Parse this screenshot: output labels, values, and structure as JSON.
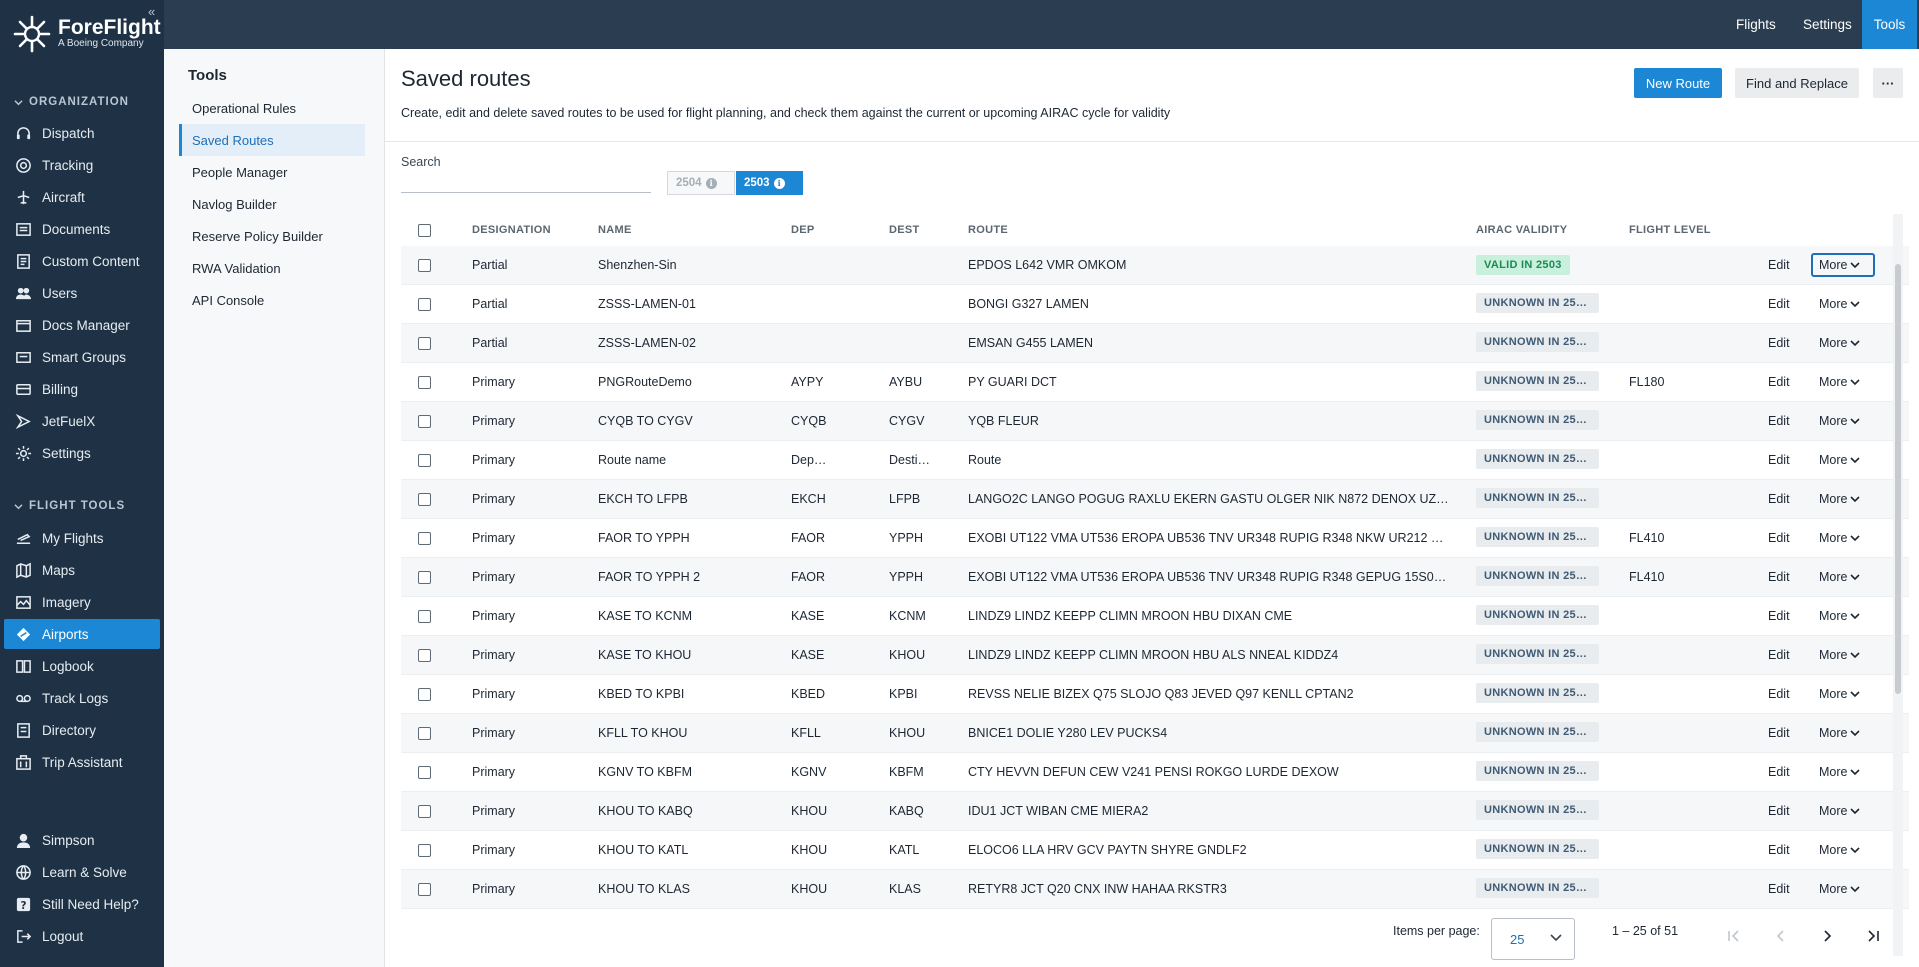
{
  "brand": {
    "name": "ForeFlight",
    "sub": "A Boeing Company"
  },
  "nav": {
    "org_heading": "ORGANIZATION",
    "org_items": [
      {
        "label": "Dispatch",
        "icon": "headset-icon"
      },
      {
        "label": "Tracking",
        "icon": "tracking-icon"
      },
      {
        "label": "Aircraft",
        "icon": "plane-icon"
      },
      {
        "label": "Documents",
        "icon": "documents-icon"
      },
      {
        "label": "Custom Content",
        "icon": "custom-content-icon"
      },
      {
        "label": "Users",
        "icon": "users-icon"
      },
      {
        "label": "Docs Manager",
        "icon": "docs-manager-icon"
      },
      {
        "label": "Smart Groups",
        "icon": "smart-groups-icon"
      },
      {
        "label": "Billing",
        "icon": "billing-icon"
      },
      {
        "label": "JetFuelX",
        "icon": "jetfuelx-icon"
      },
      {
        "label": "Settings",
        "icon": "gear-icon"
      }
    ],
    "tools_heading": "FLIGHT TOOLS",
    "tools_items": [
      {
        "label": "My Flights",
        "icon": "my-flights-icon"
      },
      {
        "label": "Maps",
        "icon": "map-icon"
      },
      {
        "label": "Imagery",
        "icon": "imagery-icon"
      },
      {
        "label": "Airports",
        "icon": "airport-icon"
      },
      {
        "label": "Logbook",
        "icon": "logbook-icon"
      },
      {
        "label": "Track Logs",
        "icon": "track-logs-icon"
      },
      {
        "label": "Directory",
        "icon": "directory-icon"
      },
      {
        "label": "Trip Assistant",
        "icon": "trip-assistant-icon"
      }
    ],
    "bottom_items": [
      {
        "label": "Simpson",
        "icon": "user-icon"
      },
      {
        "label": "Learn & Solve",
        "icon": "globe-icon"
      },
      {
        "label": "Still Need Help?",
        "icon": "help-icon"
      },
      {
        "label": "Logout",
        "icon": "logout-icon"
      }
    ]
  },
  "topbar": {
    "flights": "Flights",
    "settings": "Settings",
    "tools": "Tools"
  },
  "tools_sidebar": {
    "title": "Tools",
    "items": [
      "Operational Rules",
      "Saved Routes",
      "People Manager",
      "Navlog Builder",
      "Reserve Policy Builder",
      "RWA Validation",
      "API Console"
    ]
  },
  "page": {
    "title": "Saved routes",
    "description": "Create, edit and delete saved routes to be used for flight planning, and check them against the current or upcoming AIRAC cycle for validity",
    "new_route": "New Route",
    "find_replace": "Find and Replace",
    "more_menu": "···",
    "search_label": "Search",
    "search_value": "",
    "cycle_a": "2504",
    "cycle_b": "2503",
    "info_glyph": "i"
  },
  "table": {
    "headers": {
      "designation": "DESIGNATION",
      "name": "NAME",
      "dep": "DEP",
      "dest": "DEST",
      "route": "ROUTE",
      "airac": "AIRAC VALIDITY",
      "fl": "FLIGHT LEVEL"
    },
    "edit_label": "Edit",
    "more_label": "More",
    "rows": [
      {
        "designation": "Partial",
        "name": "Shenzhen-Sin",
        "dep": "",
        "dest": "",
        "route": "EPDOS L642 VMR OMKOM",
        "airac": "VALID IN 2503",
        "airac_status": "valid",
        "fl": ""
      },
      {
        "designation": "Partial",
        "name": "ZSSS-LAMEN-01",
        "dep": "",
        "dest": "",
        "route": "BONGI G327 LAMEN",
        "airac": "UNKNOWN IN 250…",
        "airac_status": "unknown",
        "fl": ""
      },
      {
        "designation": "Partial",
        "name": "ZSSS-LAMEN-02",
        "dep": "",
        "dest": "",
        "route": "EMSAN G455 LAMEN",
        "airac": "UNKNOWN IN 250…",
        "airac_status": "unknown",
        "fl": ""
      },
      {
        "designation": "Primary",
        "name": "PNGRouteDemo",
        "dep": "AYPY",
        "dest": "AYBU",
        "route": "PY GUARI DCT",
        "airac": "UNKNOWN IN 250…",
        "airac_status": "unknown",
        "fl": "FL180"
      },
      {
        "designation": "Primary",
        "name": "CYQB TO CYGV",
        "dep": "CYQB",
        "dest": "CYGV",
        "route": "YQB FLEUR",
        "airac": "UNKNOWN IN 250…",
        "airac_status": "unknown",
        "fl": ""
      },
      {
        "designation": "Primary",
        "name": "Route name",
        "dep": "Dep…",
        "dest": "Desti…",
        "route": "Route",
        "airac": "UNKNOWN IN 250…",
        "airac_status": "unknown",
        "fl": ""
      },
      {
        "designation": "Primary",
        "name": "EKCH TO LFPB",
        "dep": "EKCH",
        "dest": "LFPB",
        "route": "LANGO2C LANGO POGUG RAXLU EKERN GASTU OLGER NIK N872 DENOX UZ3…",
        "airac": "UNKNOWN IN 250…",
        "airac_status": "unknown",
        "fl": ""
      },
      {
        "designation": "Primary",
        "name": "FAOR TO YPPH",
        "dep": "FAOR",
        "dest": "YPPH",
        "route": "EXOBI UT122 VMA UT536 EROPA UB536 TNV UR348 RUPIG R348 NKW UR212 G…",
        "airac": "UNKNOWN IN 250…",
        "airac_status": "unknown",
        "fl": "FL410"
      },
      {
        "designation": "Primary",
        "name": "FAOR TO YPPH 2",
        "dep": "FAOR",
        "dest": "YPPH",
        "route": "EXOBI UT122 VMA UT536 EROPA UB536 TNV UR348 RUPIG R348 GEPUG 15S06…",
        "airac": "UNKNOWN IN 250…",
        "airac_status": "unknown",
        "fl": "FL410"
      },
      {
        "designation": "Primary",
        "name": "KASE TO KCNM",
        "dep": "KASE",
        "dest": "KCNM",
        "route": "LINDZ9 LINDZ KEEPP CLIMN MROON HBU DIXAN CME",
        "airac": "UNKNOWN IN 250…",
        "airac_status": "unknown",
        "fl": ""
      },
      {
        "designation": "Primary",
        "name": "KASE TO KHOU",
        "dep": "KASE",
        "dest": "KHOU",
        "route": "LINDZ9 LINDZ KEEPP CLIMN MROON HBU ALS NNEAL KIDDZ4",
        "airac": "UNKNOWN IN 250…",
        "airac_status": "unknown",
        "fl": ""
      },
      {
        "designation": "Primary",
        "name": "KBED TO KPBI",
        "dep": "KBED",
        "dest": "KPBI",
        "route": "REVSS NELIE BIZEX Q75 SLOJO Q83 JEVED Q97 KENLL CPTAN2",
        "airac": "UNKNOWN IN 250…",
        "airac_status": "unknown",
        "fl": ""
      },
      {
        "designation": "Primary",
        "name": "KFLL TO KHOU",
        "dep": "KFLL",
        "dest": "KHOU",
        "route": "BNICE1 DOLIE Y280 LEV PUCKS4",
        "airac": "UNKNOWN IN 250…",
        "airac_status": "unknown",
        "fl": ""
      },
      {
        "designation": "Primary",
        "name": "KGNV TO KBFM",
        "dep": "KGNV",
        "dest": "KBFM",
        "route": "CTY HEVVN DEFUN CEW V241 PENSI ROKGO LURDE DEXOW",
        "airac": "UNKNOWN IN 250…",
        "airac_status": "unknown",
        "fl": ""
      },
      {
        "designation": "Primary",
        "name": "KHOU TO KABQ",
        "dep": "KHOU",
        "dest": "KABQ",
        "route": "IDU1 JCT WIBAN CME MIERA2",
        "airac": "UNKNOWN IN 250…",
        "airac_status": "unknown",
        "fl": ""
      },
      {
        "designation": "Primary",
        "name": "KHOU TO KATL",
        "dep": "KHOU",
        "dest": "KATL",
        "route": "ELOCO6 LLA HRV GCV PAYTN SHYRE GNDLF2",
        "airac": "UNKNOWN IN 250…",
        "airac_status": "unknown",
        "fl": ""
      },
      {
        "designation": "Primary",
        "name": "KHOU TO KLAS",
        "dep": "KHOU",
        "dest": "KLAS",
        "route": "RETYR8 JCT Q20 CNX INW HAHAA RKSTR3",
        "airac": "UNKNOWN IN 250…",
        "airac_status": "unknown",
        "fl": ""
      }
    ]
  },
  "pagination": {
    "items_per_page_label": "Items per page:",
    "items_per_page": "25",
    "range": "1 – 25 of 51"
  },
  "colors": {
    "accent": "#1c87d4",
    "nav_bg": "#1f3245",
    "topbar_bg": "#2b3e51",
    "valid_bg": "#c9f0dc",
    "valid_fg": "#1b8a53"
  }
}
